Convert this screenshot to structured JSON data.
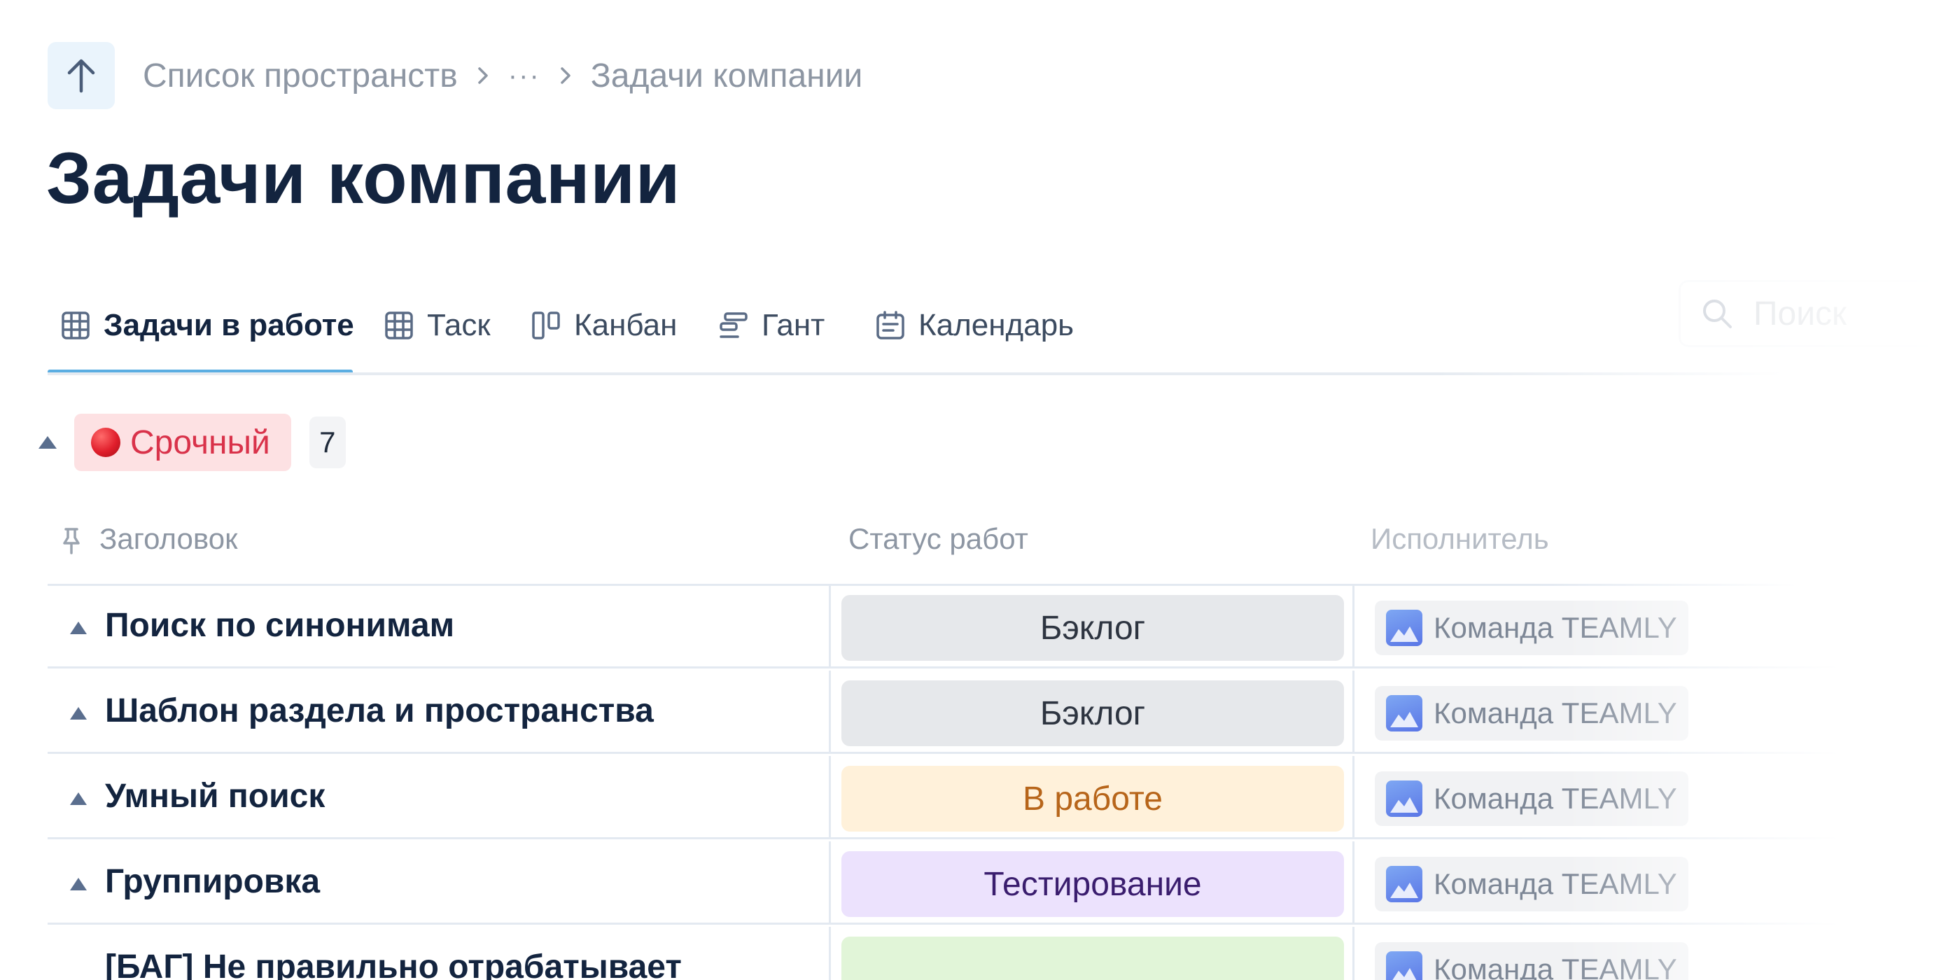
{
  "breadcrumb": {
    "items": [
      "Список пространств",
      "···",
      "Задачи компании"
    ]
  },
  "page": {
    "title": "Задачи компании"
  },
  "tabs": [
    {
      "label": "Задачи в работе",
      "icon": "table-icon",
      "active": true
    },
    {
      "label": "Таск",
      "icon": "table-icon",
      "active": false
    },
    {
      "label": "Канбан",
      "icon": "kanban-icon",
      "active": false
    },
    {
      "label": "Гант",
      "icon": "gantt-icon",
      "active": false
    },
    {
      "label": "Календарь",
      "icon": "calendar-icon",
      "active": false
    }
  ],
  "search": {
    "placeholder": "Поиск"
  },
  "group": {
    "label": "Срочный",
    "count": "7",
    "color": "#d9324a"
  },
  "columns": {
    "title": "Заголовок",
    "status": "Статус работ",
    "assignee": "Исполнитель"
  },
  "rows": [
    {
      "title": "Поиск по синонимам",
      "status": "Бэклог",
      "assignee": "Команда TEAMLY"
    },
    {
      "title": "Шаблон раздела и пространства",
      "status": "Бэклог",
      "assignee": "Команда TEAMLY"
    },
    {
      "title": "Умный поиск",
      "status": "В работе",
      "assignee": "Команда TEAMLY"
    },
    {
      "title": "Группировка",
      "status": "Тестирование",
      "assignee": "Команда TEAMLY"
    },
    {
      "title": "[БАГ] Не правильно отрабатывает",
      "status": "",
      "assignee": "Команда TEAMLY"
    }
  ],
  "status_colors": {
    "Бэклог": {
      "bg": "#e6e8eb",
      "fg": "#2d3440"
    },
    "В работе": {
      "bg": "#fff1da",
      "fg": "#b7651a"
    },
    "Тестирование": {
      "bg": "#ece2fd",
      "fg": "#3a1d6e"
    },
    "done": {
      "bg": "#e1f5d8",
      "fg": "#2f6b23"
    }
  }
}
